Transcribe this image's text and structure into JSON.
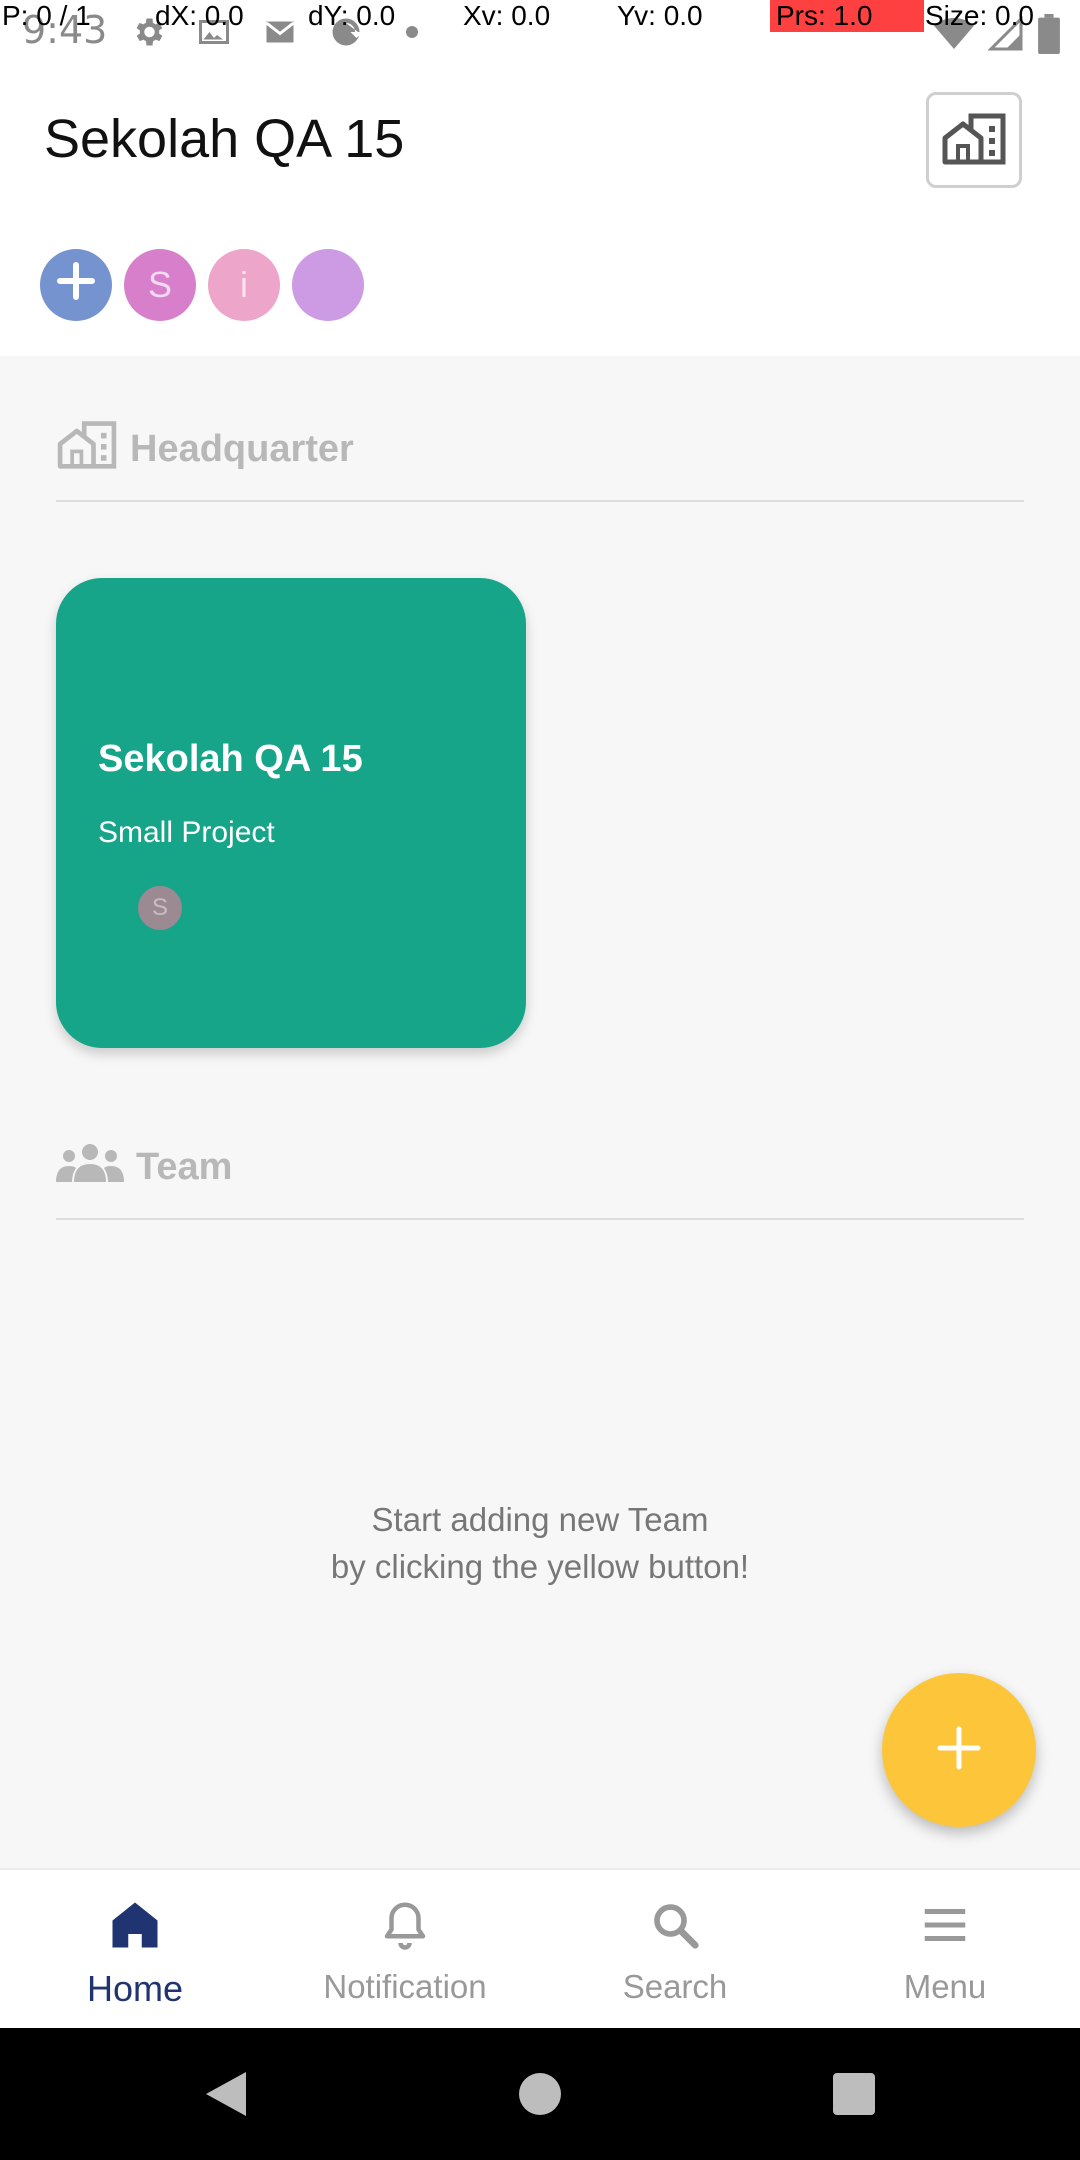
{
  "status_bar": {
    "time": "9:43",
    "icons": [
      "gear-icon",
      "image-icon",
      "mail-icon",
      "sync-icon",
      "dot-icon"
    ],
    "right_icons": [
      "wifi-icon",
      "signal-icon",
      "battery-icon"
    ]
  },
  "debug_overlay": {
    "pointer": "P: 0 / 1",
    "dx": "dX: 0.0",
    "dy": "dY: 0.0",
    "xv": "Xv: 0.0",
    "yv": "Yv: 0.0",
    "prs": "Prs: 1.0",
    "size": "Size: 0.0"
  },
  "header": {
    "title": "Sekolah QA 15",
    "org_icon": "building-icon"
  },
  "members": [
    {
      "initial": "",
      "color": "#7593cf",
      "icon": "plus-icon"
    },
    {
      "initial": "S",
      "color": "#d77fcb"
    },
    {
      "initial": "i",
      "color": "#eda6c9"
    },
    {
      "initial": "",
      "color": "#cc9be3"
    }
  ],
  "sections": {
    "headquarter": {
      "label": "Headquarter",
      "icon": "building-icon"
    },
    "team": {
      "label": "Team",
      "icon": "people-icon"
    }
  },
  "project_card": {
    "title": "Sekolah QA 15",
    "subtitle": "Small Project",
    "member_initial": "S",
    "color": "#17a589"
  },
  "empty_state": {
    "line1": "Start adding new Team",
    "line2": "by clicking the yellow button!"
  },
  "fab": {
    "icon": "plus-icon",
    "color": "#fdc63a"
  },
  "bottom_nav": {
    "items": [
      {
        "label": "Home",
        "icon": "home-icon",
        "active": true
      },
      {
        "label": "Notification",
        "icon": "bell-icon",
        "active": false
      },
      {
        "label": "Search",
        "icon": "search-icon",
        "active": false
      },
      {
        "label": "Menu",
        "icon": "menu-icon",
        "active": false
      }
    ]
  },
  "system_nav": [
    "back-icon",
    "home-circle-icon",
    "recents-icon"
  ]
}
